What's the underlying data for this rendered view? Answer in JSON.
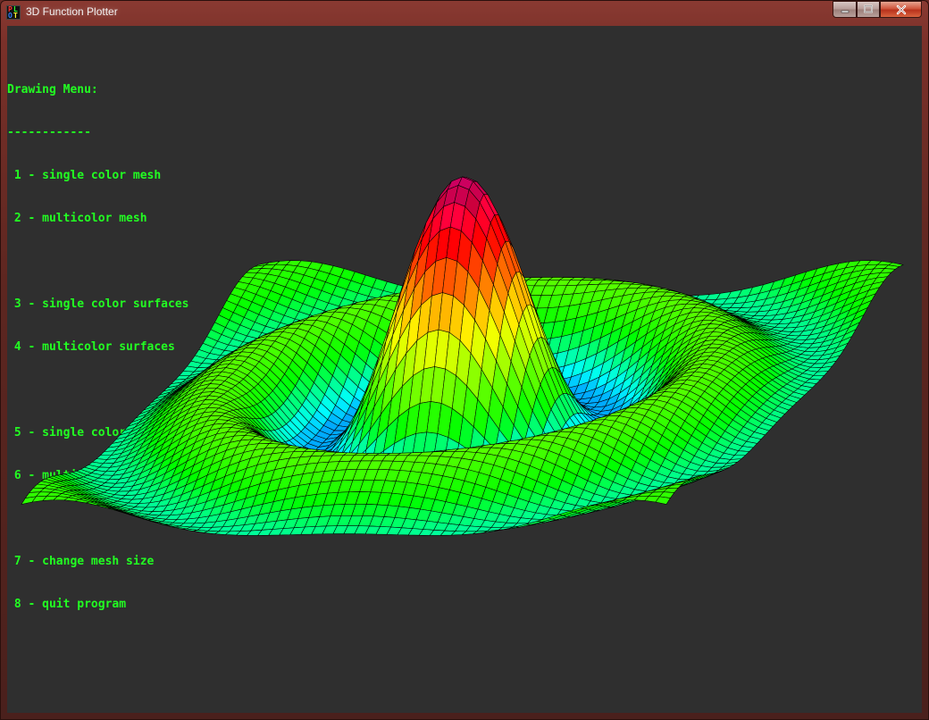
{
  "window": {
    "title": "3D Function Plotter",
    "icon": "app-icon",
    "controls": [
      "minimize-icon",
      "maximize-icon",
      "close-icon"
    ]
  },
  "menu": {
    "heading": "Drawing Menu:",
    "underline": "------------",
    "items": [
      " 1 - single color mesh",
      " 2 - multicolor mesh",
      "",
      " 3 - single color surfaces",
      " 4 - multicolor surfaces",
      "",
      " 5 - single color mesh & surfaces",
      " 6 - multicolor mesh & surfaces",
      "",
      " 7 - change mesh size",
      " 8 - quit program"
    ]
  },
  "colors": {
    "menu_text": "#22ff22",
    "background": "#2f2f2f",
    "mesh_line": "#000000"
  },
  "plot": {
    "function": "sombrero",
    "mode": "multicolor mesh & surfaces",
    "mesh_size": 60
  }
}
